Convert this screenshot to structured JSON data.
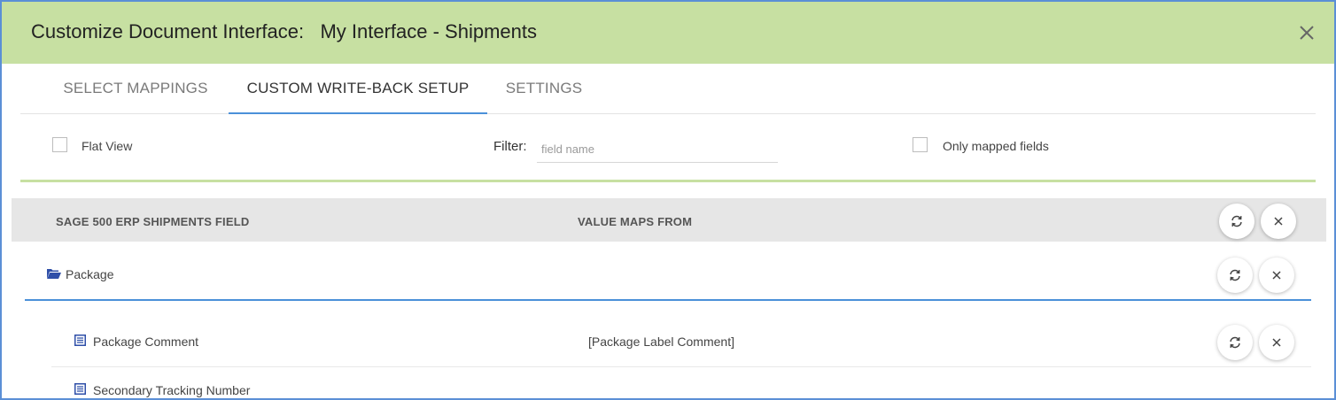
{
  "dialog": {
    "title": "Customize Document Interface:   My Interface - Shipments",
    "close_icon": "close-icon"
  },
  "tabs": [
    {
      "label": "SELECT MAPPINGS",
      "active": false
    },
    {
      "label": "CUSTOM WRITE-BACK SETUP",
      "active": true
    },
    {
      "label": "SETTINGS",
      "active": false
    }
  ],
  "filters": {
    "flat_view_label": "Flat View",
    "flat_view_checked": false,
    "filter_label": "Filter:",
    "filter_placeholder": "field name",
    "filter_value": "",
    "only_mapped_label": "Only mapped fields",
    "only_mapped_checked": false
  },
  "grid": {
    "columns": [
      "SAGE 500 ERP SHIPMENTS FIELD",
      "VALUE MAPS FROM"
    ],
    "header_actions": [
      "refresh-icon",
      "close-icon"
    ],
    "rows": [
      {
        "type": "group",
        "icon": "folder-open-icon",
        "label": "Package",
        "value": "",
        "actions": [
          "refresh-icon",
          "close-icon"
        ]
      },
      {
        "type": "field",
        "icon": "list-icon",
        "label": "Package Comment",
        "value": "[Package Label Comment]",
        "actions": [
          "refresh-icon",
          "close-icon"
        ]
      },
      {
        "type": "field",
        "icon": "list-icon",
        "label": "Secondary Tracking Number",
        "value": "",
        "actions": []
      }
    ]
  },
  "colors": {
    "title_bar": "#c7e0a2",
    "accent": "#4a90d9",
    "folder_icon": "#2f4fa8"
  }
}
